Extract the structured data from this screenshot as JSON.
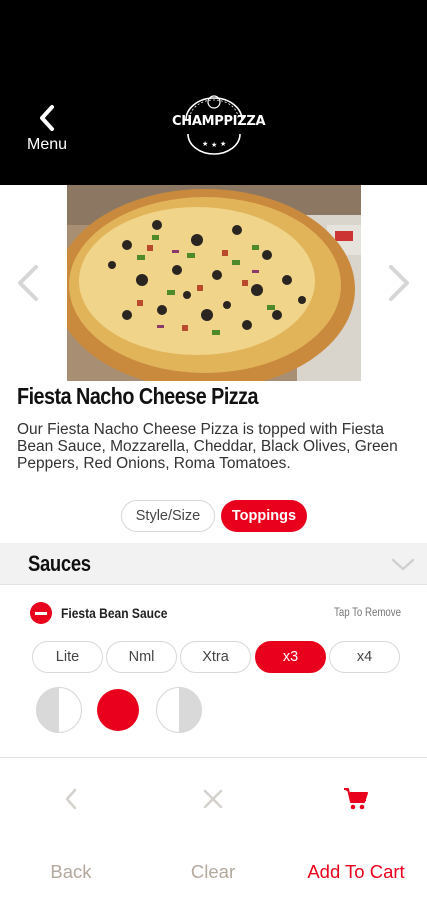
{
  "header": {
    "menu_label": "Menu",
    "logo_text": "CHAMPPIZZA"
  },
  "product": {
    "title": "Fiesta Nacho Cheese Pizza",
    "description": "Our Fiesta Nacho Cheese Pizza is topped with Fiesta Bean Sauce, Mozzarella, Cheddar, Black Olives, Green Peppers, Red Onions, Roma Tomatoes."
  },
  "tabs": [
    {
      "label": "Style/Size",
      "active": false
    },
    {
      "label": "Toppings",
      "active": true
    }
  ],
  "sauces": {
    "section_title": "Sauces",
    "item": {
      "name": "Fiesta Bean Sauce",
      "tap_to_remove": "Tap To Remove"
    },
    "amounts": [
      {
        "label": "Lite",
        "selected": false
      },
      {
        "label": "Nml",
        "selected": false
      },
      {
        "label": "Xtra",
        "selected": false
      },
      {
        "label": "x3",
        "selected": true
      },
      {
        "label": "x4",
        "selected": false
      }
    ],
    "portion_selected": "whole"
  },
  "actions": {
    "back_label": "Back",
    "clear_label": "Clear",
    "add_to_cart_label": "Add To Cart"
  },
  "colors": {
    "accent": "#e8001c",
    "header_bg": "#000000",
    "muted_label": "#b3a89c"
  }
}
